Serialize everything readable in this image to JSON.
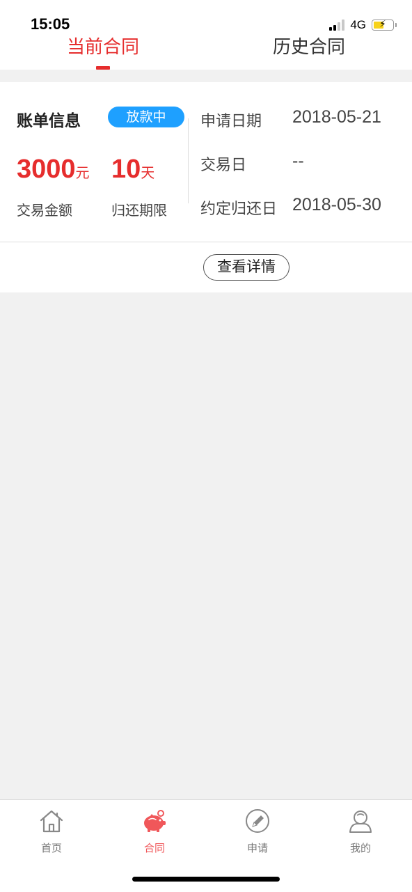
{
  "status_bar": {
    "time": "15:05",
    "network": "4G"
  },
  "tabs": [
    {
      "label": "当前合同",
      "active": true
    },
    {
      "label": "历史合同",
      "active": false
    }
  ],
  "bill": {
    "title": "账单信息",
    "status": "放款中",
    "amount_value": "3000",
    "amount_unit": "元",
    "amount_label": "交易金额",
    "term_value": "10",
    "term_unit": "天",
    "term_label": "归还期限",
    "rows": [
      {
        "label": "申请日期",
        "value": "2018-05-21"
      },
      {
        "label": "交易日",
        "value": "--"
      },
      {
        "label": "约定归还日",
        "value": "2018-05-30"
      }
    ],
    "detail_button": "查看详情"
  },
  "bottom_nav": [
    {
      "label": "首页",
      "icon": "home-icon",
      "active": false
    },
    {
      "label": "合同",
      "icon": "piggy-bank-icon",
      "active": true
    },
    {
      "label": "申请",
      "icon": "pencil-circle-icon",
      "active": false
    },
    {
      "label": "我的",
      "icon": "user-icon",
      "active": false
    }
  ],
  "colors": {
    "accent": "#e62d2d",
    "badge": "#1ea0ff",
    "nav_active": "#f0575a",
    "battery": "#f7d21a"
  }
}
